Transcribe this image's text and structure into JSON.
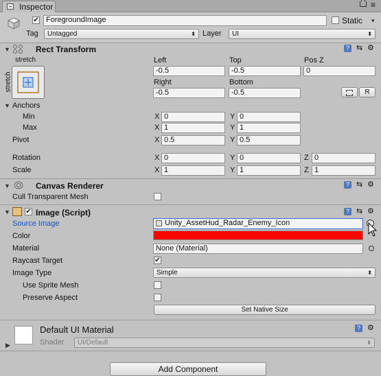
{
  "window": {
    "tab_label": "Inspector",
    "menu_glyph": "≡"
  },
  "header": {
    "active_checked": true,
    "object_name": "ForegroundImage",
    "static_label": "Static",
    "tag_label": "Tag",
    "tag_value": "Untagged",
    "layer_label": "Layer",
    "layer_value": "UI"
  },
  "rect_transform": {
    "title": "Rect Transform",
    "anchor_preset_top": "stretch",
    "anchor_preset_side": "stretch",
    "left_label": "Left",
    "left_value": "-0.5",
    "top_label": "Top",
    "top_value": "-0.5",
    "posz_label": "Pos Z",
    "posz_value": "0",
    "right_label": "Right",
    "right_value": "-0.5",
    "bottom_label": "Bottom",
    "bottom_value": "-0.5",
    "raw_button": "R",
    "anchors_label": "Anchors",
    "min_label": "Min",
    "min_x": "0",
    "min_y": "0",
    "max_label": "Max",
    "max_x": "1",
    "max_y": "1",
    "pivot_label": "Pivot",
    "pivot_x": "0.5",
    "pivot_y": "0.5",
    "rotation_label": "Rotation",
    "rot_x": "0",
    "rot_y": "0",
    "rot_z": "0",
    "scale_label": "Scale",
    "scale_x": "1",
    "scale_y": "1",
    "scale_z": "1",
    "x": "X",
    "y": "Y",
    "z": "Z"
  },
  "canvas_renderer": {
    "title": "Canvas Renderer",
    "cull_label": "Cull Transparent Mesh",
    "cull_checked": false
  },
  "image": {
    "title": "Image (Script)",
    "source_label": "Source Image",
    "source_value": "Unity_AssetHud_Radar_Enemy_Icon",
    "color_label": "Color",
    "color_value": "#ff0000",
    "material_label": "Material",
    "material_value": "None (Material)",
    "raycast_label": "Raycast Target",
    "raycast_checked": true,
    "image_type_label": "Image Type",
    "image_type_value": "Simple",
    "use_sprite_label": "Use Sprite Mesh",
    "preserve_label": "Preserve Aspect",
    "native_button": "Set Native Size"
  },
  "material_preview": {
    "title": "Default UI Material",
    "shader_label": "Shader",
    "shader_value": "UI/Default"
  },
  "footer": {
    "add_component": "Add Component"
  },
  "colors": {
    "panel": "#c2c2c2",
    "field": "#f3f3f3",
    "highlight": "#1b4fc9"
  }
}
